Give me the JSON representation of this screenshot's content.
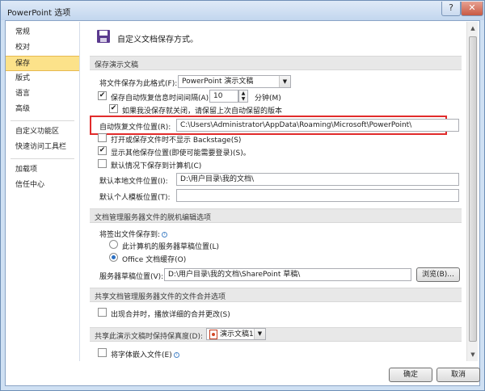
{
  "window": {
    "title": "PowerPoint 选项",
    "help": "?",
    "close": "✕"
  },
  "sidebar": {
    "items": [
      {
        "label": "常规"
      },
      {
        "label": "校对"
      },
      {
        "label": "保存",
        "active": true
      },
      {
        "label": "版式"
      },
      {
        "label": "语言"
      },
      {
        "label": "高级"
      },
      {
        "label": "自定义功能区"
      },
      {
        "label": "快速访问工具栏"
      },
      {
        "label": "加载项"
      },
      {
        "label": "信任中心"
      }
    ]
  },
  "main": {
    "header": "自定义文档保存方式。",
    "sections": {
      "save": "保存演示文稿",
      "offline": "文档管理服务器文件的脱机编辑选项",
      "merge": "共享文档管理服务器文件的文件合并选项",
      "fidelity": "共享此演示文稿时保持保真度(D):"
    },
    "save_format_label": "将文件保存为此格式(F):",
    "save_format_value": "PowerPoint 演示文稿",
    "autorecover_label": "保存自动恢复信息时间间隔(A)",
    "autorecover_minutes": "10",
    "minutes_label": "分钟(M)",
    "keep_last_label": "如果我没保存就关闭，请保留上次自动保留的版本",
    "autorecover_location_label": "自动恢复文件位置(R):",
    "autorecover_location_value": "C:\\Users\\Administrator\\AppData\\Roaming\\Microsoft\\PowerPoint\\",
    "backstage_label": "打开或保存文件时不显示 Backstage(S)",
    "show_other_label": "显示其他保存位置(即使可能需要登录)(S)。",
    "default_computer_label": "默认情况下保存到计算机(C)",
    "default_local_label": "默认本地文件位置(I):",
    "default_local_value": "D:\\用户目录\\我的文档\\",
    "template_label": "默认个人模板位置(T):",
    "template_value": "",
    "checkout_label": "将签出文件保存到:",
    "radio_server": "此计算机的服务器草稿位置(L)",
    "radio_cache": "Office 文档缓存(O)",
    "server_drafts_label": "服务器草稿位置(V):",
    "server_drafts_value": "D:\\用户目录\\我的文档\\SharePoint 草稿\\",
    "browse_label": "浏览(B)...",
    "merge_label": "出现合并时，播放详细的合并更改(S)",
    "fidelity_doc": "演示文稿1",
    "embed_fonts_label": "将字体嵌入文件(E)"
  },
  "footer": {
    "ok": "确定",
    "cancel": "取消"
  },
  "colors": {
    "highlight": "#e12b2b",
    "active_item": "#fce28a"
  }
}
